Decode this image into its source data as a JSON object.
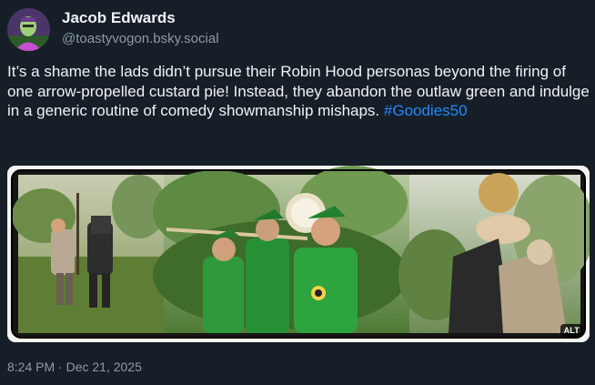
{
  "author": {
    "display_name": "Jacob Edwards",
    "handle": "@toastyvogon.bsky.social",
    "avatar_icon": "user-avatar"
  },
  "post": {
    "text": "It’s a shame the lads didn’t pursue their Robin Hood personas beyond the firing of one arrow-propelled custard pie! Instead, they abandon the outlaw green and indulge in a generic routine of comedy showmanship mishaps. ",
    "hashtag": "#Goodies50",
    "timestamp": "8:24 PM · Dec 21, 2025"
  },
  "media": {
    "alt_label": "ALT",
    "panels": 3
  },
  "colors": {
    "background": "#161e27",
    "text": "#f1f3f5",
    "muted": "#8c9aab",
    "link": "#208bfe"
  }
}
